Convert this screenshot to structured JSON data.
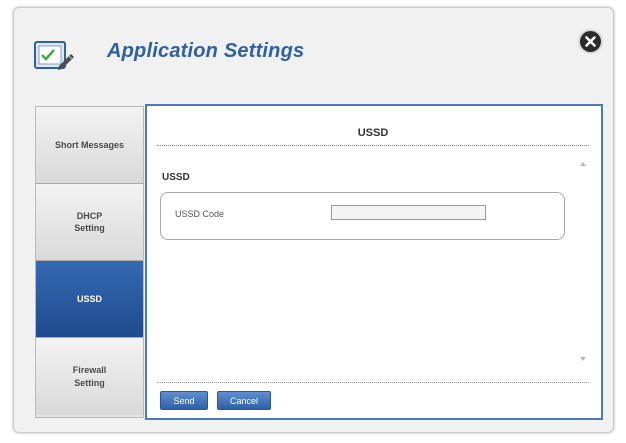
{
  "dialog": {
    "title": "Application Settings",
    "icon": "settings-document-icon",
    "close_icon": "close-icon"
  },
  "sidebar": {
    "items": [
      {
        "label": "Short Messages",
        "active": false
      },
      {
        "label": "DHCP\nSetting",
        "active": false
      },
      {
        "label": "USSD",
        "active": true
      },
      {
        "label": "Firewall\nSetting",
        "active": false
      }
    ]
  },
  "panel": {
    "title": "USSD",
    "section_label": "USSD",
    "field": {
      "label": "USSD Code",
      "value": "",
      "placeholder": ""
    },
    "buttons": {
      "send": "Send",
      "cancel": "Cancel"
    }
  },
  "colors": {
    "accent": "#2f5fa6",
    "active_tab": "#2a5aa0",
    "panel_border": "#4a78b8"
  }
}
